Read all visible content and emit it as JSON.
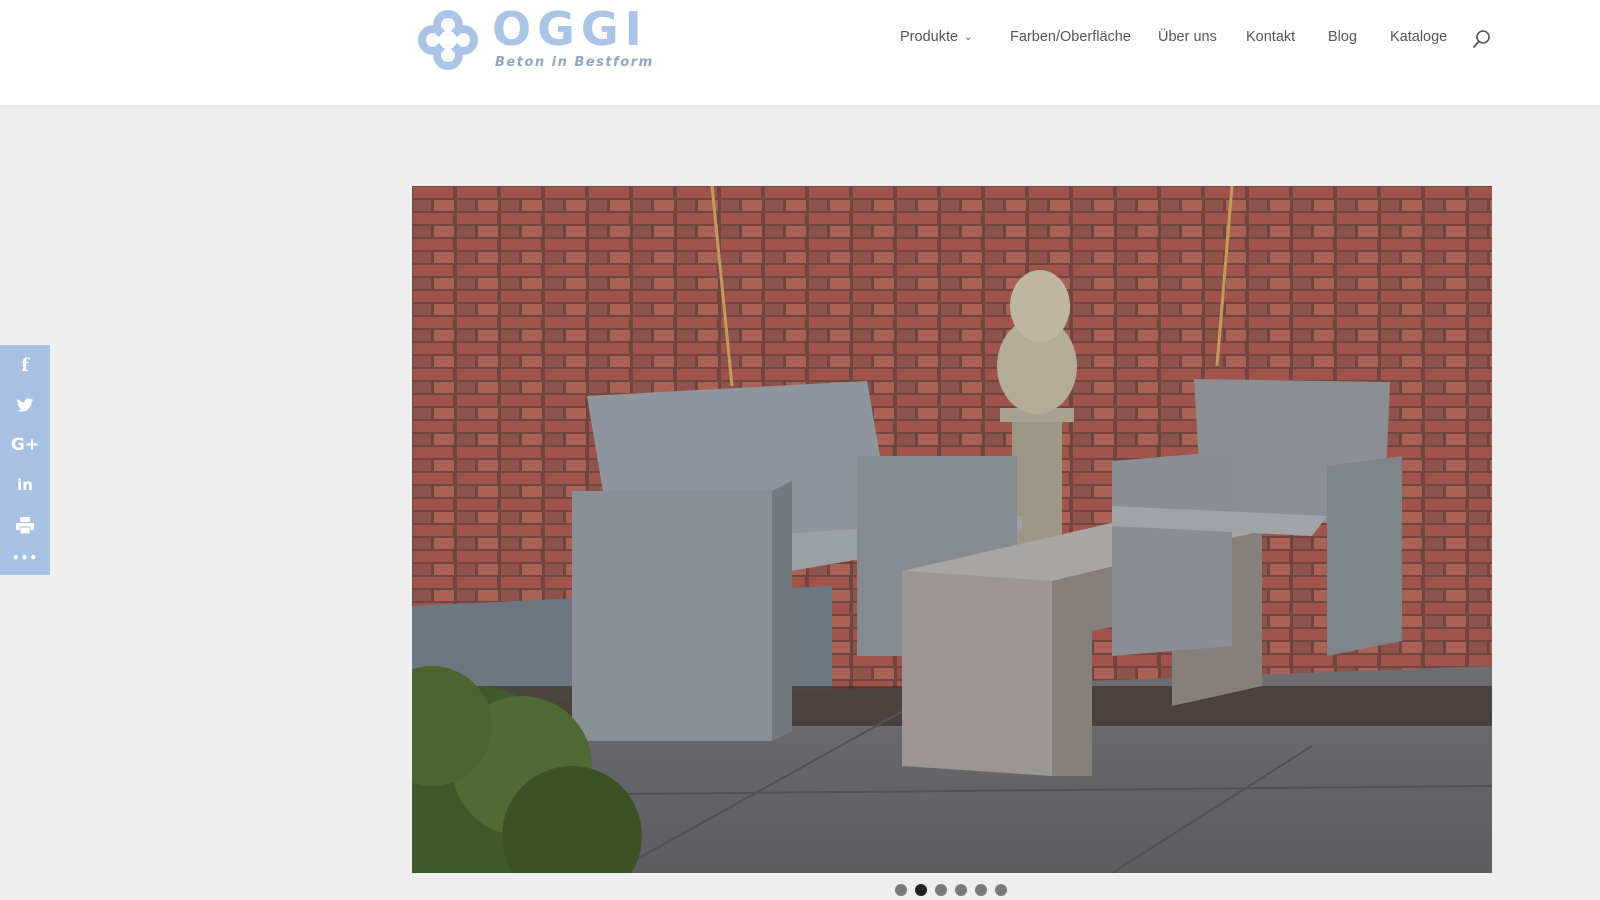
{
  "logo": {
    "brand": "OGGI",
    "tagline": "Beton in Bestform",
    "color": "#a9c4e4"
  },
  "nav": {
    "items": [
      {
        "label": "Produkte",
        "has_dropdown": true
      },
      {
        "label": "Farben/Oberfläche"
      },
      {
        "label": "Über uns"
      },
      {
        "label": "Kontakt"
      },
      {
        "label": "Blog"
      },
      {
        "label": "Kataloge"
      }
    ],
    "search_icon": "search-icon"
  },
  "share": {
    "color": "#a8c1e2",
    "items": [
      {
        "icon": "facebook-icon",
        "glyph": "f"
      },
      {
        "icon": "twitter-icon",
        "glyph": ""
      },
      {
        "icon": "google-plus-icon",
        "glyph": "G+"
      },
      {
        "icon": "linkedin-icon",
        "glyph": "in"
      },
      {
        "icon": "print-icon",
        "glyph": ""
      },
      {
        "icon": "more-icon",
        "glyph": "•••"
      }
    ]
  },
  "slider": {
    "description_icon": "photo-concrete-garden-furniture",
    "slide_count": 6,
    "active_slide": 2
  }
}
